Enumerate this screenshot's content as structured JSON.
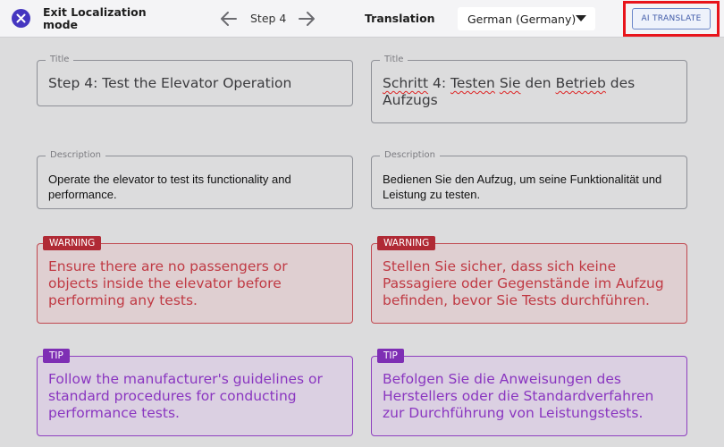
{
  "header": {
    "exit_label": "Exit Localization mode",
    "step_label": "Step 4",
    "translation_label": "Translation",
    "language_selected": "German (Germany)",
    "ai_translate_label": "AI TRANSLATE",
    "icons": {
      "exit": "close-icon",
      "prev": "arrow-left-icon",
      "next": "arrow-right-icon",
      "dropdown": "caret-down-icon"
    },
    "colors": {
      "exit_button": "#4536c0",
      "highlight": "#e8141b"
    }
  },
  "source": {
    "title_legend": "Title",
    "title": "Step 4: Test the Elevator Operation",
    "description_legend": "Description",
    "description": "Operate the elevator to test its functionality and performance.",
    "warning_badge": "WARNING",
    "warning": "Ensure there are no passengers or objects inside the elevator before performing any tests.",
    "tip_badge": "TIP",
    "tip": "Follow the manufacturer's guidelines or standard procedures for conducting performance tests."
  },
  "target": {
    "title_legend": "Title",
    "title_parts": [
      "Schritt",
      " 4: ",
      "Testen",
      " ",
      "Sie",
      " den ",
      "Betrieb",
      " des Aufzugs"
    ],
    "description_legend": "Description",
    "description": "Bedienen Sie den Aufzug, um seine Funktionalität und Leistung zu testen.",
    "warning_badge": "WARNING",
    "warning": "Stellen Sie sicher, dass sich keine Passagiere oder Gegenstände im Aufzug befinden, bevor Sie Tests durchführen.",
    "tip_badge": "TIP",
    "tip": "Befolgen Sie die Anweisungen des Herstellers oder die Standardverfahren zur Durchführung von Leistungstests."
  }
}
